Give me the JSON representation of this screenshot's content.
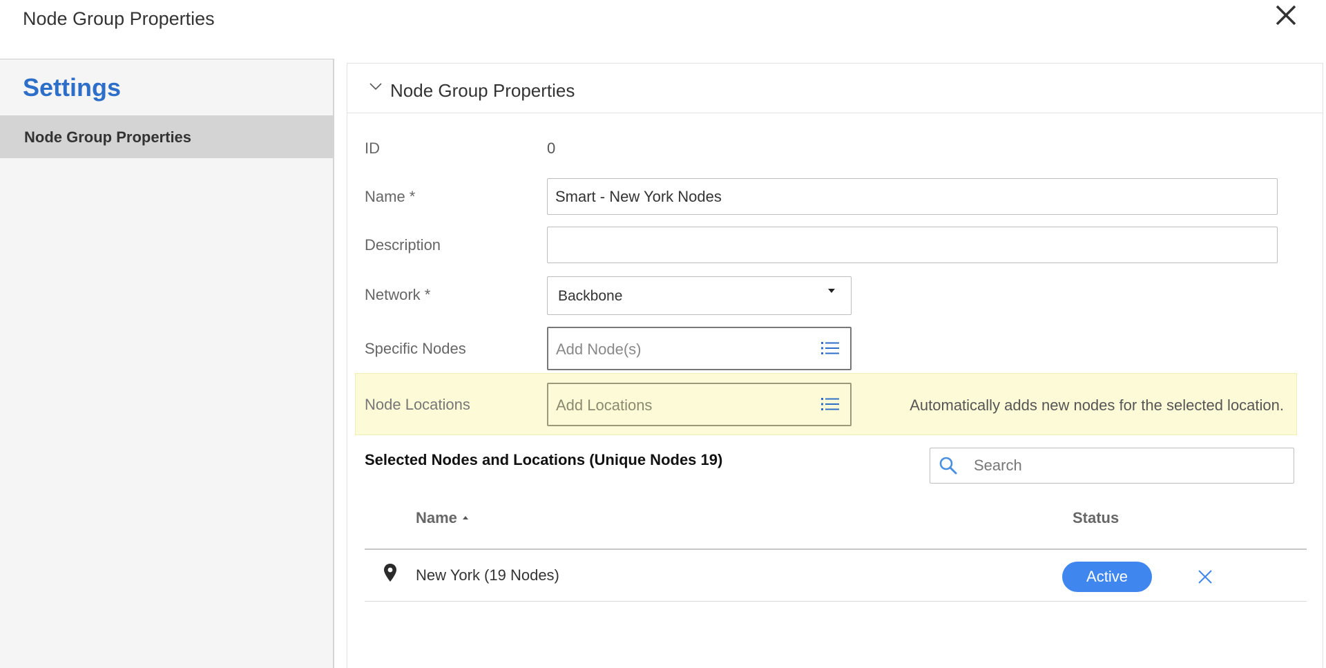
{
  "dialog": {
    "title": "Node Group Properties"
  },
  "sidebar": {
    "title": "Settings",
    "items": [
      {
        "label": "Node Group Properties",
        "selected": true
      }
    ]
  },
  "panel": {
    "header": "Node Group Properties",
    "fields": {
      "id": {
        "label": "ID",
        "value": "0"
      },
      "name": {
        "label": "Name *",
        "value": "Smart - New York Nodes"
      },
      "description": {
        "label": "Description",
        "value": ""
      },
      "network": {
        "label": "Network *",
        "value": "Backbone"
      },
      "specific_nodes": {
        "label": "Specific Nodes",
        "placeholder": "Add Node(s)"
      },
      "node_locations": {
        "label": "Node Locations",
        "placeholder": "Add Locations",
        "hint": "Automatically adds new nodes for the selected location."
      }
    }
  },
  "selected": {
    "title": "Selected Nodes and Locations (Unique Nodes 19)",
    "search_placeholder": "Search",
    "columns": {
      "name": "Name",
      "status": "Status"
    },
    "rows": [
      {
        "icon": "location-pin-icon",
        "name": "New York (19 Nodes)",
        "status": "Active"
      }
    ]
  },
  "colors": {
    "accent": "#2d6fc8",
    "badge": "#3f87ee",
    "highlight": "#fdfbd7",
    "sidebar_bg": "#f5f5f5",
    "sidebar_selected": "#d4d4d4"
  }
}
